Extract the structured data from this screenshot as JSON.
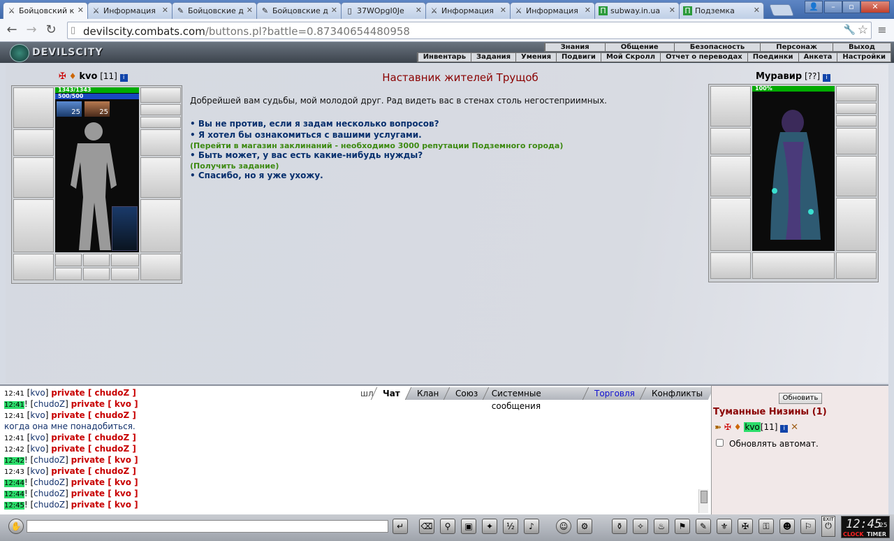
{
  "browser": {
    "tabs": [
      {
        "label": "Бойцовский к",
        "icon": "swords-icon",
        "active": true
      },
      {
        "label": "Информация",
        "icon": "swords-icon",
        "active": false
      },
      {
        "label": "Бойцовские д",
        "icon": "pen-icon",
        "active": false
      },
      {
        "label": "Бойцовские д",
        "icon": "pen-icon",
        "active": false
      },
      {
        "label": "37WOpgI0Je",
        "icon": "page-icon",
        "active": false
      },
      {
        "label": "Информация",
        "icon": "swords-icon",
        "active": false
      },
      {
        "label": "Информация",
        "icon": "swords-icon",
        "active": false
      },
      {
        "label": "subway.in.ua",
        "icon": "subway-icon",
        "active": false
      },
      {
        "label": "Подземка",
        "icon": "subway-icon",
        "active": false
      }
    ],
    "url_host": "devilscity.combats.com",
    "url_path": "/buttons.pl?battle=0.87340654480958"
  },
  "site": {
    "logo": "DEVILSCITY",
    "menu_top": [
      "Знания",
      "Общение",
      "Безопасность",
      "Персонаж",
      "Выход"
    ],
    "menu_bottom": [
      "Инвентарь",
      "Задания",
      "Умения",
      "Подвиги",
      "Мой Скролл",
      "Отчет о переводах",
      "Поединки",
      "Анкета",
      "Настройки"
    ]
  },
  "player": {
    "name": "kvo",
    "level": "[11]",
    "hp": "1343/1343",
    "mana": "500/500",
    "buff1": "25",
    "buff2": "25"
  },
  "npc": {
    "name": "Муравир",
    "level": "[??]",
    "hp": "100%",
    "title": "Наставник жителей Трущоб",
    "greeting": "Добрейшей вам судьбы, мой молодой друг. Рад видеть вас в стенах столь негостеприимных.",
    "options": [
      "• Вы не против, если я задам несколько вопросов?",
      "• Я хотел бы ознакомиться с вашими услугами.",
      "(Перейти в магазин заклинаний - необходимо 3000 репутации Подземного города)",
      "• Быть может, у вас есть какие-нибудь нужды?",
      "(Получить задание)",
      "• Спасибо, но я уже ухожу."
    ]
  },
  "chat": {
    "tabs": [
      "Чат",
      "Клан",
      "Союз",
      "Системные сообщения",
      "Торговля",
      "Конфликты"
    ],
    "tab_prefix": "шл",
    "lines": [
      {
        "time": "12:41",
        "hl": false,
        "nick": "kvo",
        "to": "chudoZ",
        "mark": ""
      },
      {
        "time": "12:41",
        "hl": true,
        "nick": "chudoZ",
        "to": "kvo",
        "mark": "!"
      },
      {
        "time": "12:41",
        "hl": false,
        "nick": "kvo",
        "to": "chudoZ",
        "mark": ""
      },
      {
        "text": "когда она мне понадобиться."
      },
      {
        "time": "12:41",
        "hl": false,
        "nick": "kvo",
        "to": "chudoZ",
        "mark": ""
      },
      {
        "time": "12:42",
        "hl": false,
        "nick": "kvo",
        "to": "chudoZ",
        "mark": ""
      },
      {
        "time": "12:42",
        "hl": true,
        "nick": "chudoZ",
        "to": "kvo",
        "mark": "!"
      },
      {
        "time": "12:43",
        "hl": false,
        "nick": "kvo",
        "to": "chudoZ",
        "mark": ""
      },
      {
        "time": "12:44",
        "hl": true,
        "nick": "chudoZ",
        "to": "kvo",
        "mark": "!"
      },
      {
        "time": "12:44",
        "hl": true,
        "nick": "chudoZ",
        "to": "kvo",
        "mark": "!"
      },
      {
        "time": "12:45",
        "hl": true,
        "nick": "chudoZ",
        "to": "kvo",
        "mark": "!"
      }
    ],
    "private_word": "private"
  },
  "location": {
    "refresh": "Обновить",
    "name": "Туманные Низины (1)",
    "user": "kvo",
    "user_level": "[11]",
    "auto_refresh": "Обновлять автомат."
  },
  "clock": {
    "time": "12:45",
    "seconds": "25",
    "clock_label": "CLOCK",
    "timer_label": "TIMER",
    "exit_label": "EXIT"
  }
}
